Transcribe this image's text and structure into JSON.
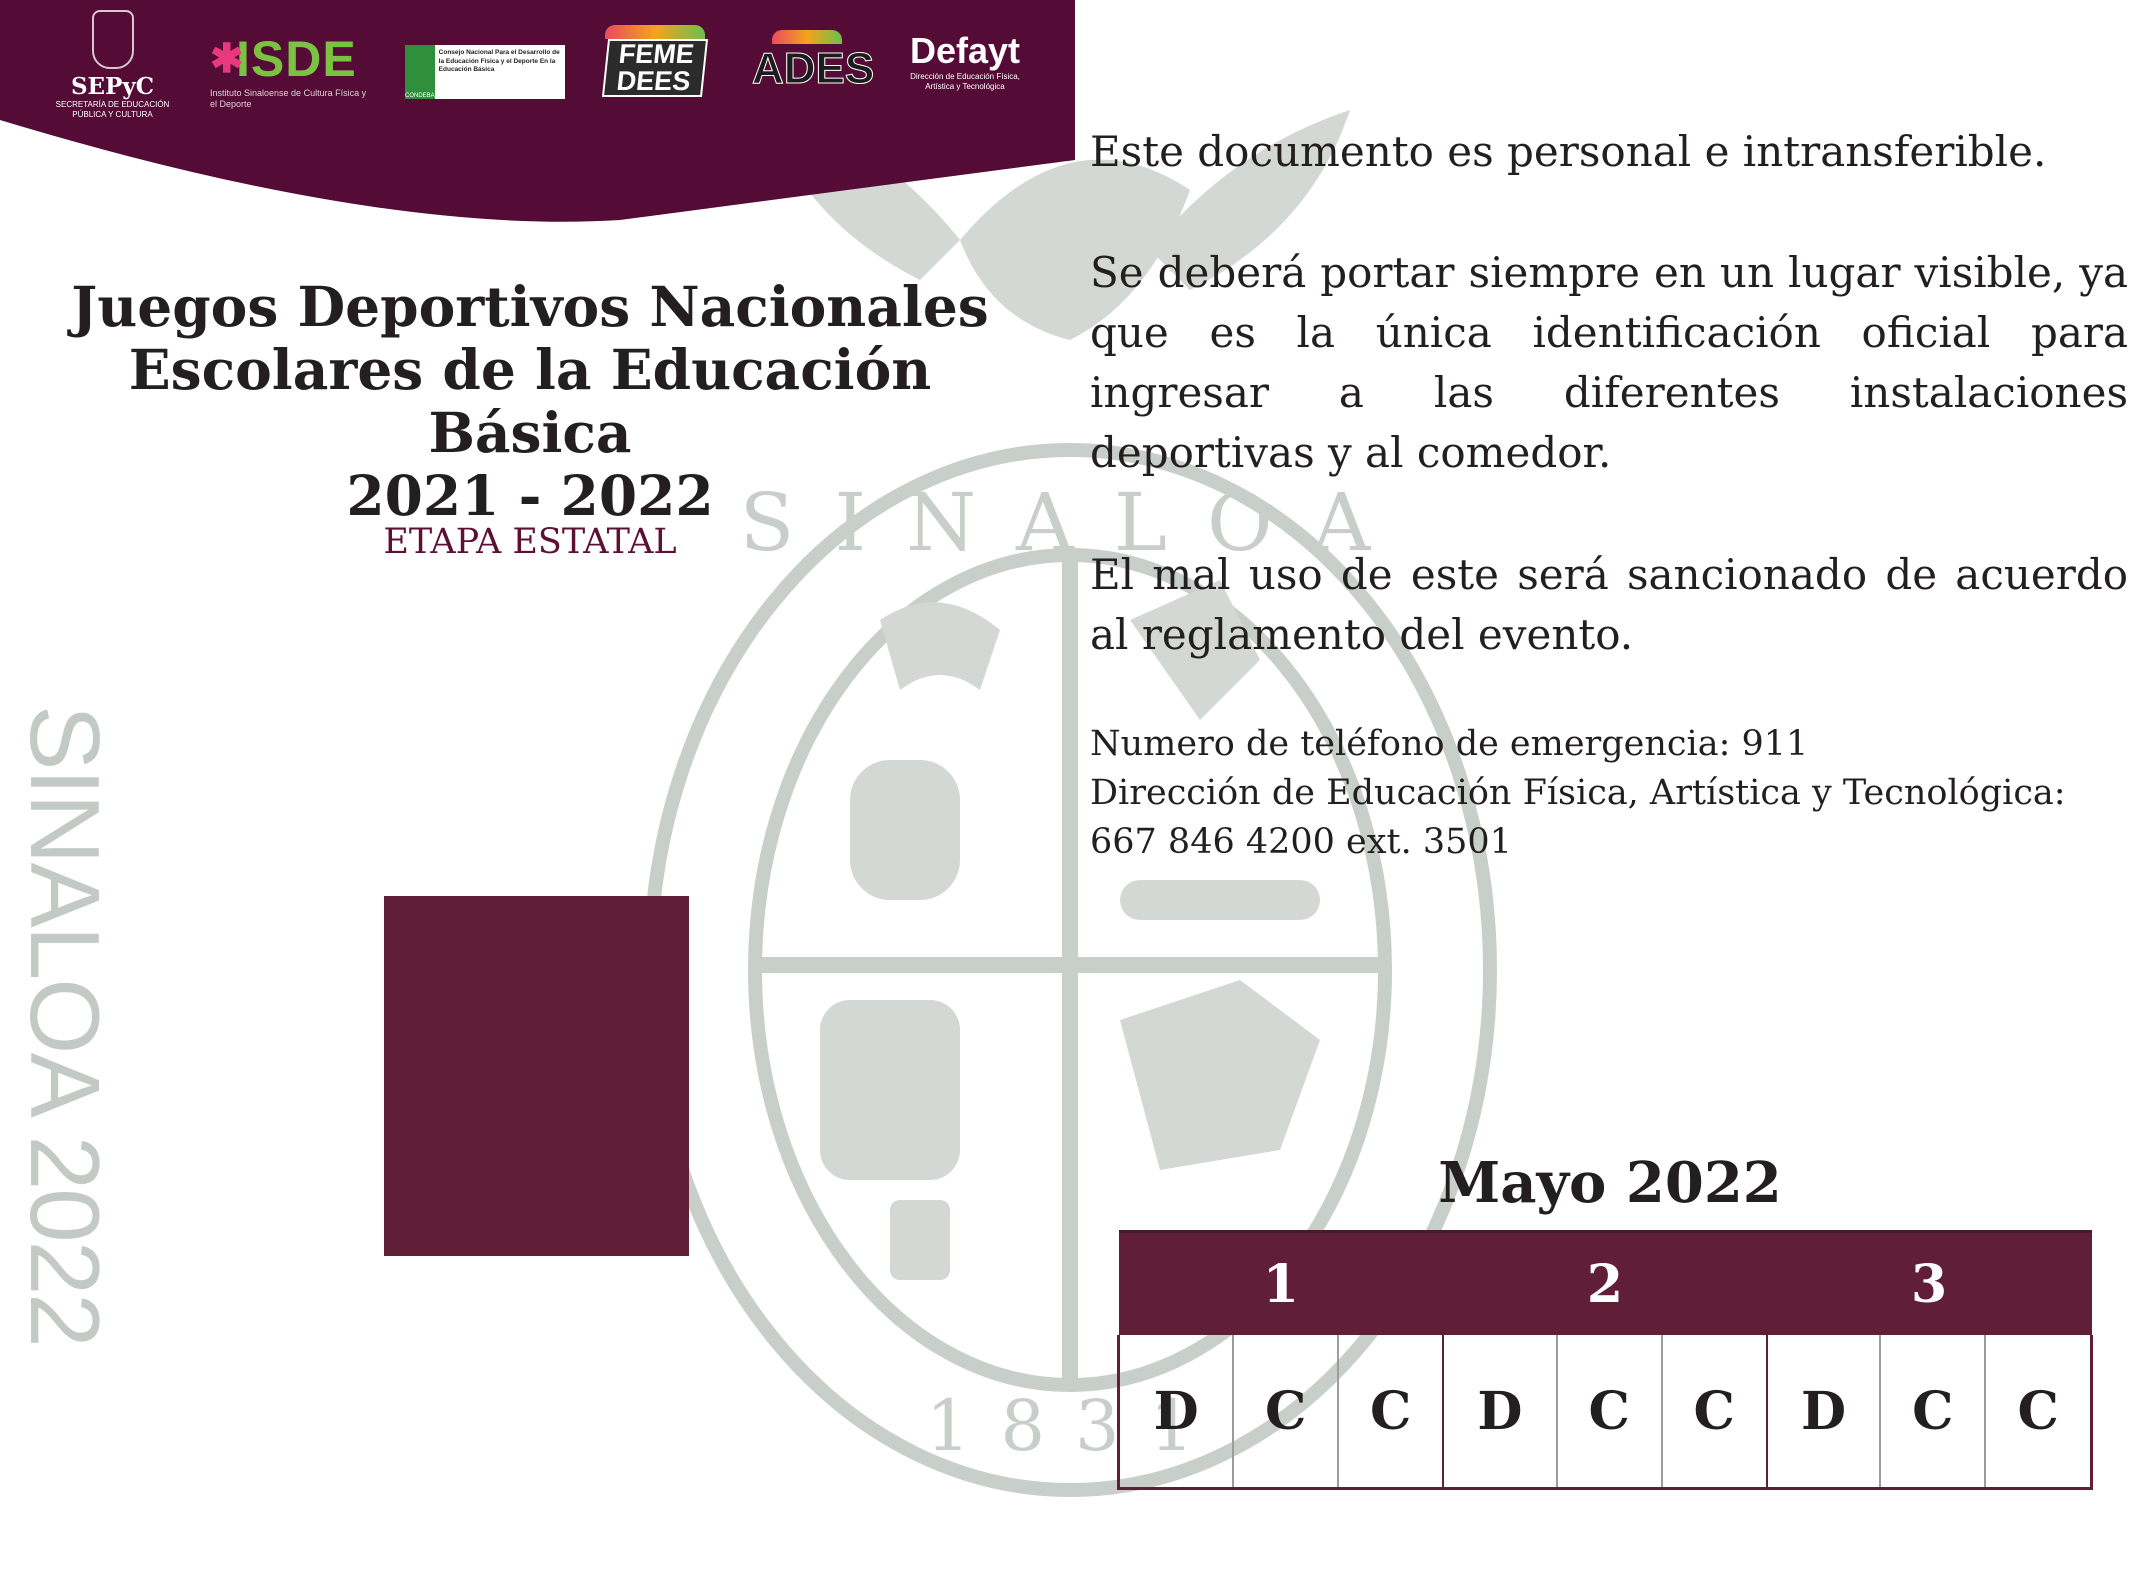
{
  "header": {
    "logos": {
      "sepyc": {
        "name": "SEPyC",
        "sub": "SECRETARÍA DE EDUCACIÓN PÚBLICA Y CULTURA"
      },
      "isde": {
        "name": "ISDE",
        "sub": "Instituto Sinaloense de Cultura Física y el Deporte"
      },
      "condeba": {
        "badge": "CONDEBA",
        "text": "Consejo Nacional Para el Desarrollo de la Educación Física y el Deporte En la Educación Básica"
      },
      "femedees": {
        "name_line1": "FEME",
        "name_line2": "DEES"
      },
      "ades": {
        "name": "ADES"
      },
      "defayt": {
        "name": "Defayt",
        "sub": "Dirección de Educación Física, Artística y Tecnológica"
      }
    }
  },
  "title": {
    "line1": "Juegos Deportivos Nacionales",
    "line2": "Escolares de la Educación Básica",
    "line3": "2021 - 2022"
  },
  "stage": "ETAPA ESTATAL",
  "side_text": "SINALOA 2022",
  "seal": {
    "ring_text": "SINALOA",
    "year_text": "1831"
  },
  "body": {
    "p1": "Este documento es personal e intransferible.",
    "p2": "Se deberá portar siempre en un lugar visible, ya que es la única identificación oficial para ingresar a las diferentes instalaciones deportivas y al comedor.",
    "p3": "El mal uso de este será sancionado de acuerdo al reglamento del evento."
  },
  "contact": {
    "line1": "Numero de teléfono de emergencia: 911",
    "line2": "Dirección de Educación Física, Artística y Tecnológica:",
    "line3": "667 846 4200 ext. 3501"
  },
  "schedule": {
    "month": "Mayo 2022",
    "days": [
      "1",
      "2",
      "3"
    ],
    "meals": [
      "D",
      "C",
      "C",
      "D",
      "C",
      "C",
      "D",
      "C",
      "C"
    ]
  },
  "colors": {
    "primary": "#601f37",
    "seal": "#c3cac6",
    "text": "#231f20"
  }
}
